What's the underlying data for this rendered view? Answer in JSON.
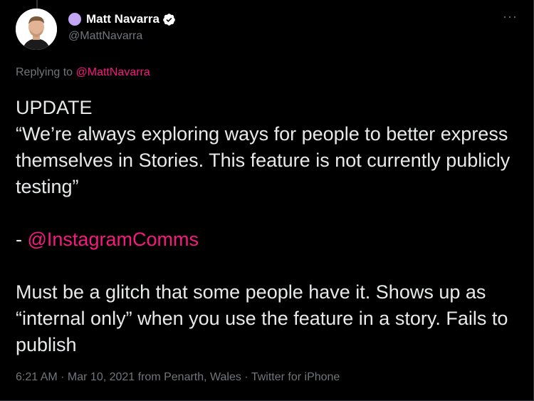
{
  "author": {
    "name": "Matt Navarra",
    "handle": "@MattNavarra",
    "dot_color": "#c3a6f5",
    "verified_icon": "verified-badge-icon"
  },
  "more_icon": "···",
  "reply": {
    "prefix": "Replying to ",
    "mention": "@MattNavarra"
  },
  "body": {
    "line1": "UPDATE",
    "quote": "“We’re always exploring ways for people to better express themselves in Stories. This feature is not currently publicly testing”",
    "attribution_prefix": "- ",
    "attribution_mention": "@InstagramComms",
    "closing": "Must be a glitch that some people have it. Shows up as “internal only” when you use the feature in a story. Fails to publish"
  },
  "meta": {
    "time": "6:21 AM",
    "separator": " · ",
    "date": "Mar 10, 2021",
    "location": " from Penarth, Wales",
    "source": "Twitter for iPhone"
  },
  "colors": {
    "background": "#000000",
    "text": "#e7e9ea",
    "muted": "#71767b",
    "mention": "#f91880",
    "verified": "#ffffff"
  }
}
